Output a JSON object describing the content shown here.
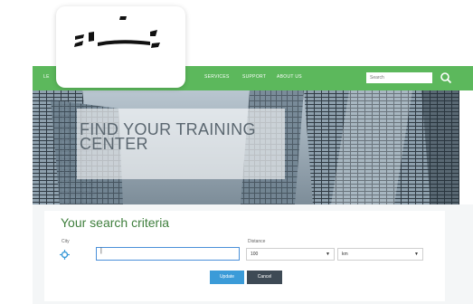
{
  "nav": {
    "left_label": "LE",
    "services": "SERVICES",
    "support": "SUPPORT",
    "about": "ABOUT US",
    "search_placeholder": "Search"
  },
  "hero": {
    "title": "FIND YOUR TRAINING CENTER"
  },
  "search_form": {
    "title": "Your search criteria",
    "city_label": "City",
    "city_value": "|",
    "distance_label": "Distance",
    "distance_value": "100",
    "unit_value": "km",
    "update_label": "Update",
    "cancel_label": "Cancel"
  },
  "colors": {
    "nav_green": "#5cb85c",
    "title_green": "#3f7f3d",
    "update_blue": "#3b9bd8",
    "cancel_dark": "#3e4a55"
  }
}
